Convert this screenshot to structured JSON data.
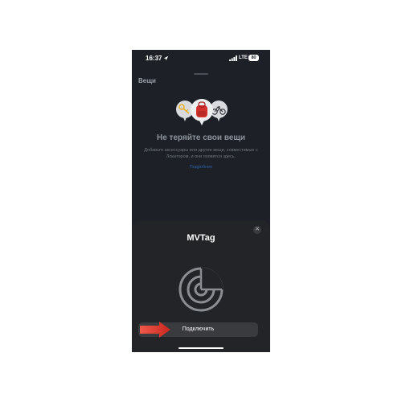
{
  "status_bar": {
    "time": "16:37",
    "network": "LTE",
    "battery": "80"
  },
  "items_screen": {
    "section_title": "Вещи",
    "empty_title": "Не теряйте свои вещи",
    "empty_description": "Добавьте аксессуары или другие вещи, совместимые с Локатором, и они появятся здесь.",
    "link_label": "Подробнее"
  },
  "sheet": {
    "title": "MVTag",
    "close_icon": "close-icon",
    "radar_icon": "radar-icon",
    "connect_button": "Подключить"
  },
  "colors": {
    "screen_bg": "#1d2127",
    "sheet_bg": "#232427",
    "button_bg": "#3a3b3f",
    "link": "#2b5fa8",
    "annotation_arrow": "#e0322a"
  }
}
